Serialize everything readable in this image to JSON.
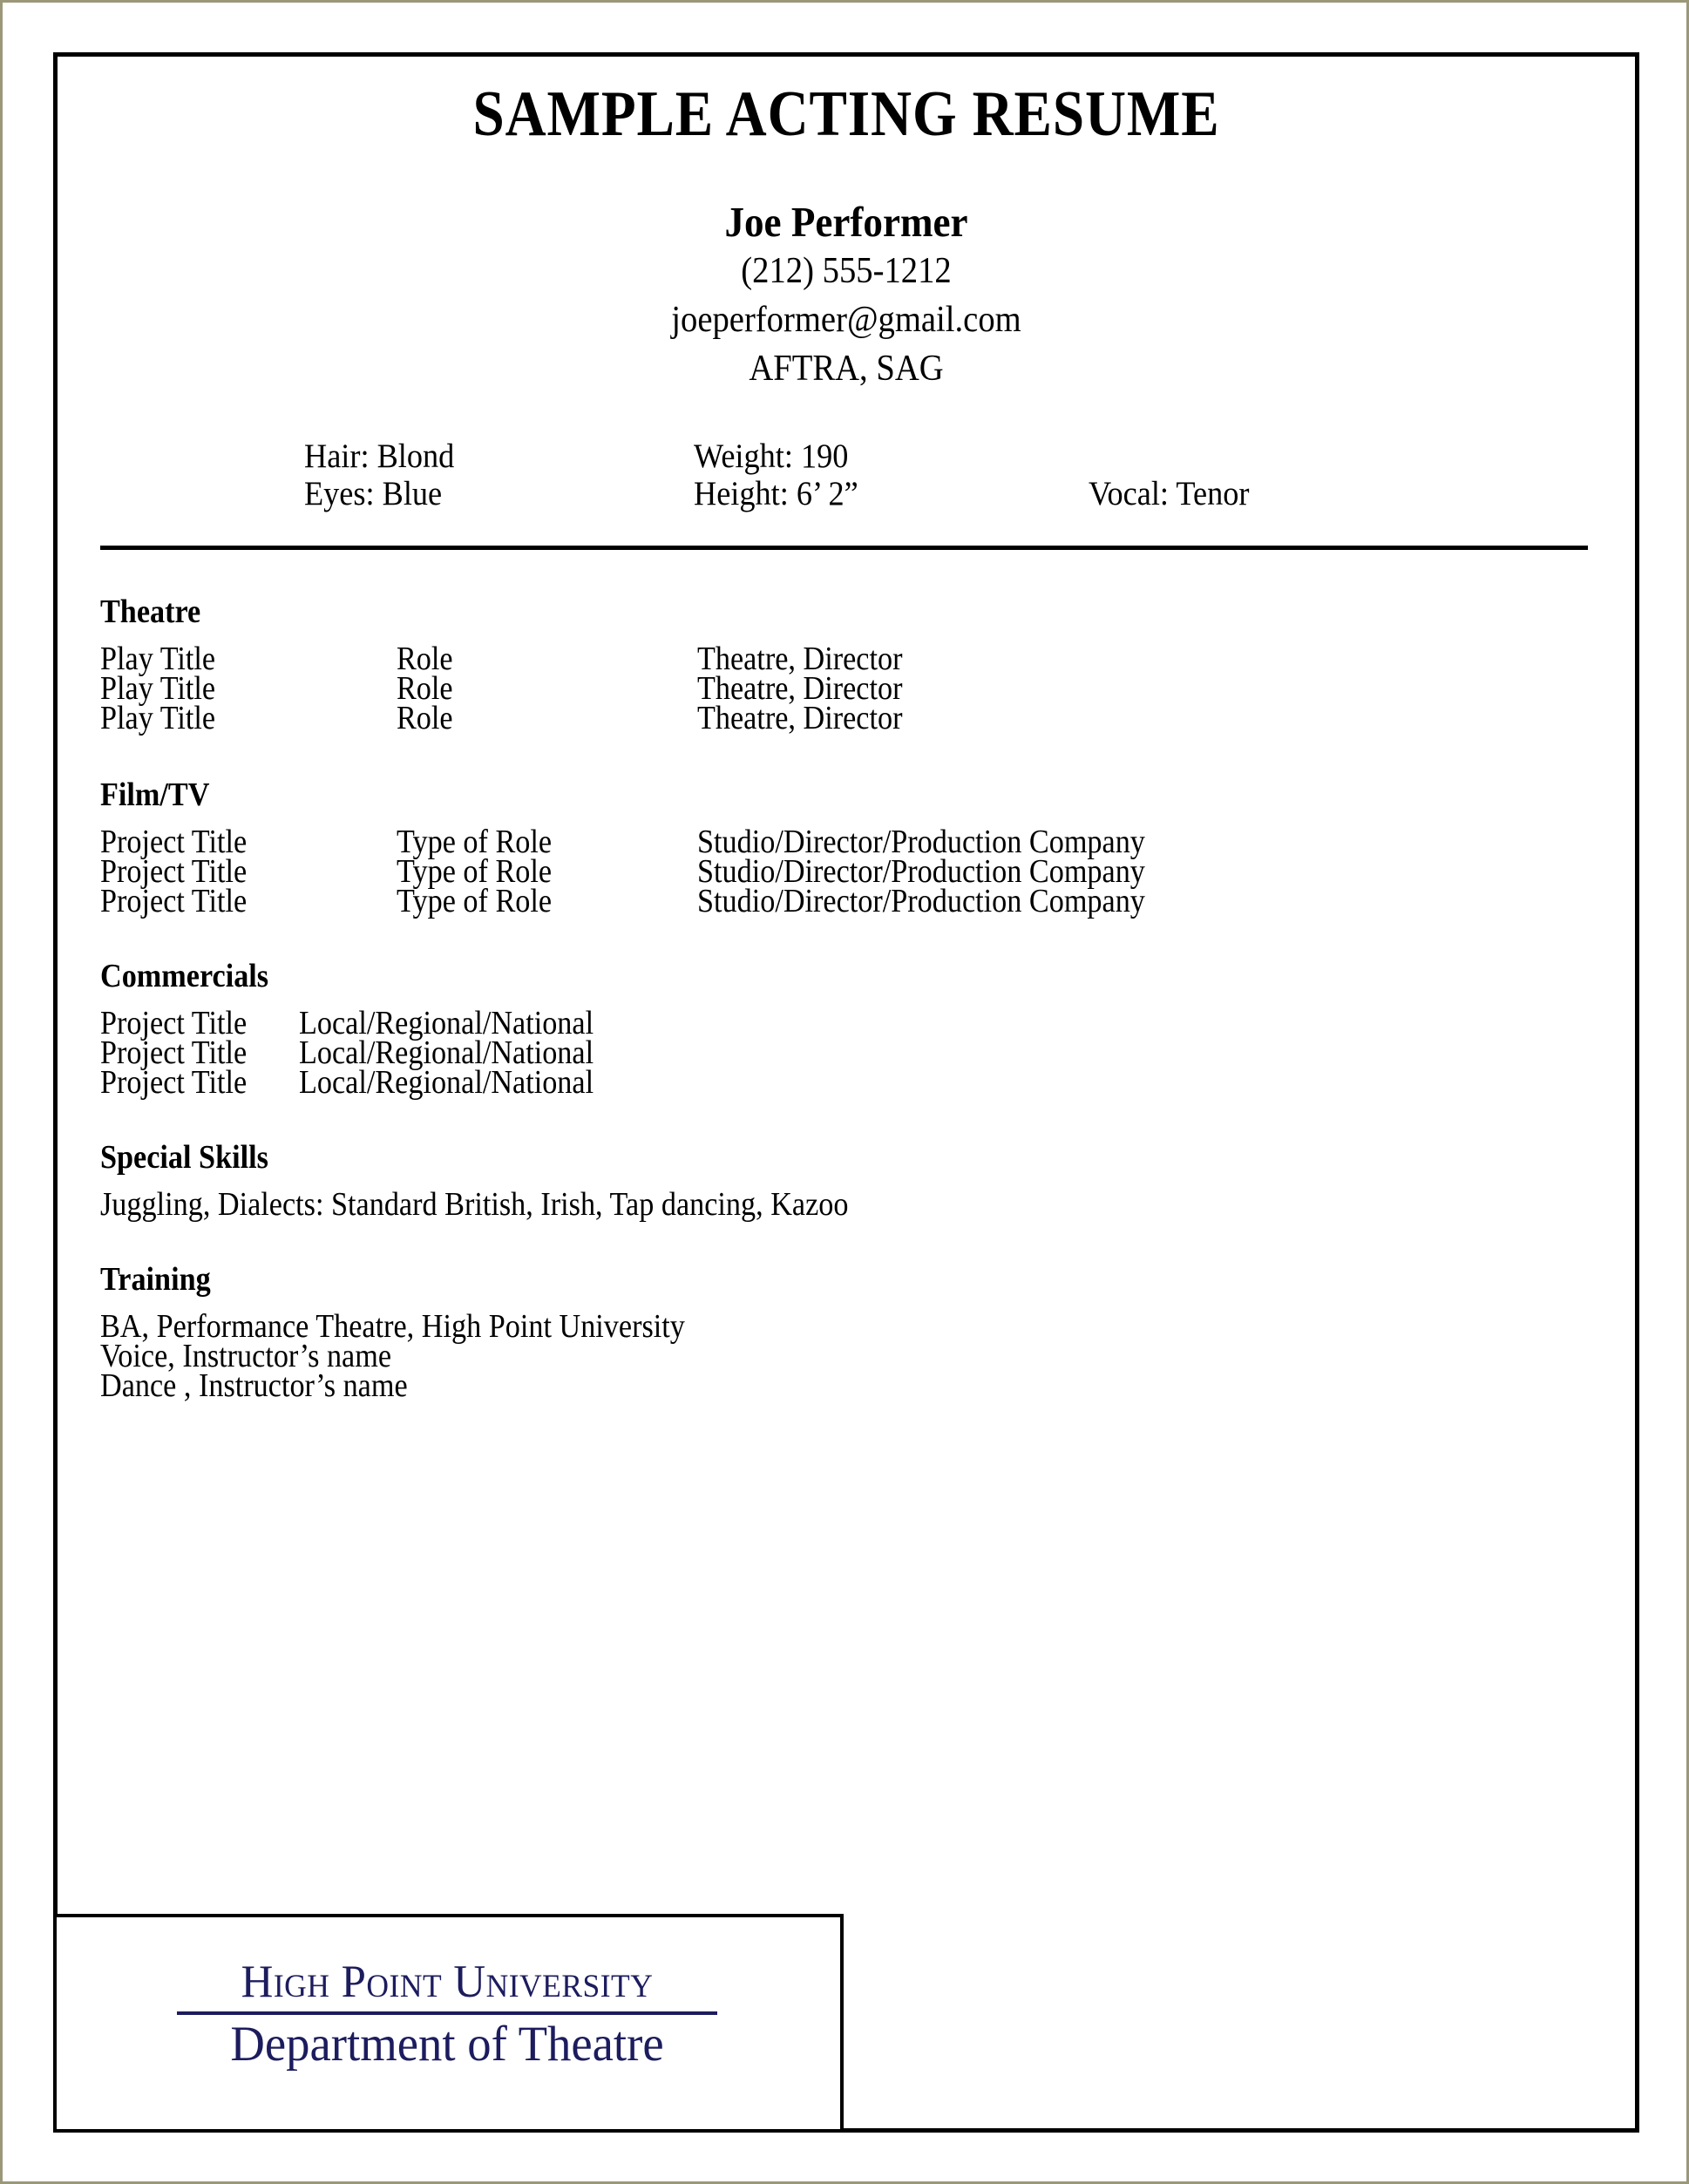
{
  "document": {
    "title": "SAMPLE ACTING RESUME"
  },
  "header": {
    "name": "Joe Performer",
    "phone": "(212) 555-1212",
    "email": "joeperformer@gmail.com",
    "unions": "AFTRA, SAG"
  },
  "stats": {
    "hair": "Hair: Blond",
    "eyes": "Eyes: Blue",
    "weight": "Weight: 190",
    "height": "Height: 6’ 2”",
    "vocal": "Vocal: Tenor"
  },
  "sections": {
    "theatre": {
      "heading": "Theatre",
      "rows": [
        {
          "title": "Play Title",
          "role": "Role",
          "detail": "Theatre, Director"
        },
        {
          "title": "Play Title",
          "role": "Role",
          "detail": "Theatre, Director"
        },
        {
          "title": "Play Title",
          "role": "Role",
          "detail": "Theatre, Director"
        }
      ]
    },
    "filmtv": {
      "heading": "Film/TV",
      "rows": [
        {
          "title": "Project Title",
          "role": "Type of Role",
          "detail": "Studio/Director/Production Company"
        },
        {
          "title": "Project Title",
          "role": "Type of Role",
          "detail": "Studio/Director/Production Company"
        },
        {
          "title": "Project Title",
          "role": "Type of Role",
          "detail": "Studio/Director/Production Company"
        }
      ]
    },
    "commercials": {
      "heading": "Commercials",
      "rows": [
        {
          "title": "Project Title",
          "role": "Local/Regional/National"
        },
        {
          "title": "Project Title",
          "role": "Local/Regional/National"
        },
        {
          "title": "Project Title",
          "role": "Local/Regional/National"
        }
      ]
    },
    "special_skills": {
      "heading": "Special Skills",
      "lines": [
        "Juggling, Dialects: Standard British, Irish, Tap dancing, Kazoo"
      ]
    },
    "training": {
      "heading": "Training",
      "lines": [
        "BA, Performance Theatre, High Point University",
        "Voice, Instructor’s name",
        "Dance , Instructor’s name"
      ]
    }
  },
  "logo": {
    "line1": "High Point University",
    "line2": "Department of Theatre",
    "color": "#1c1c5e"
  }
}
